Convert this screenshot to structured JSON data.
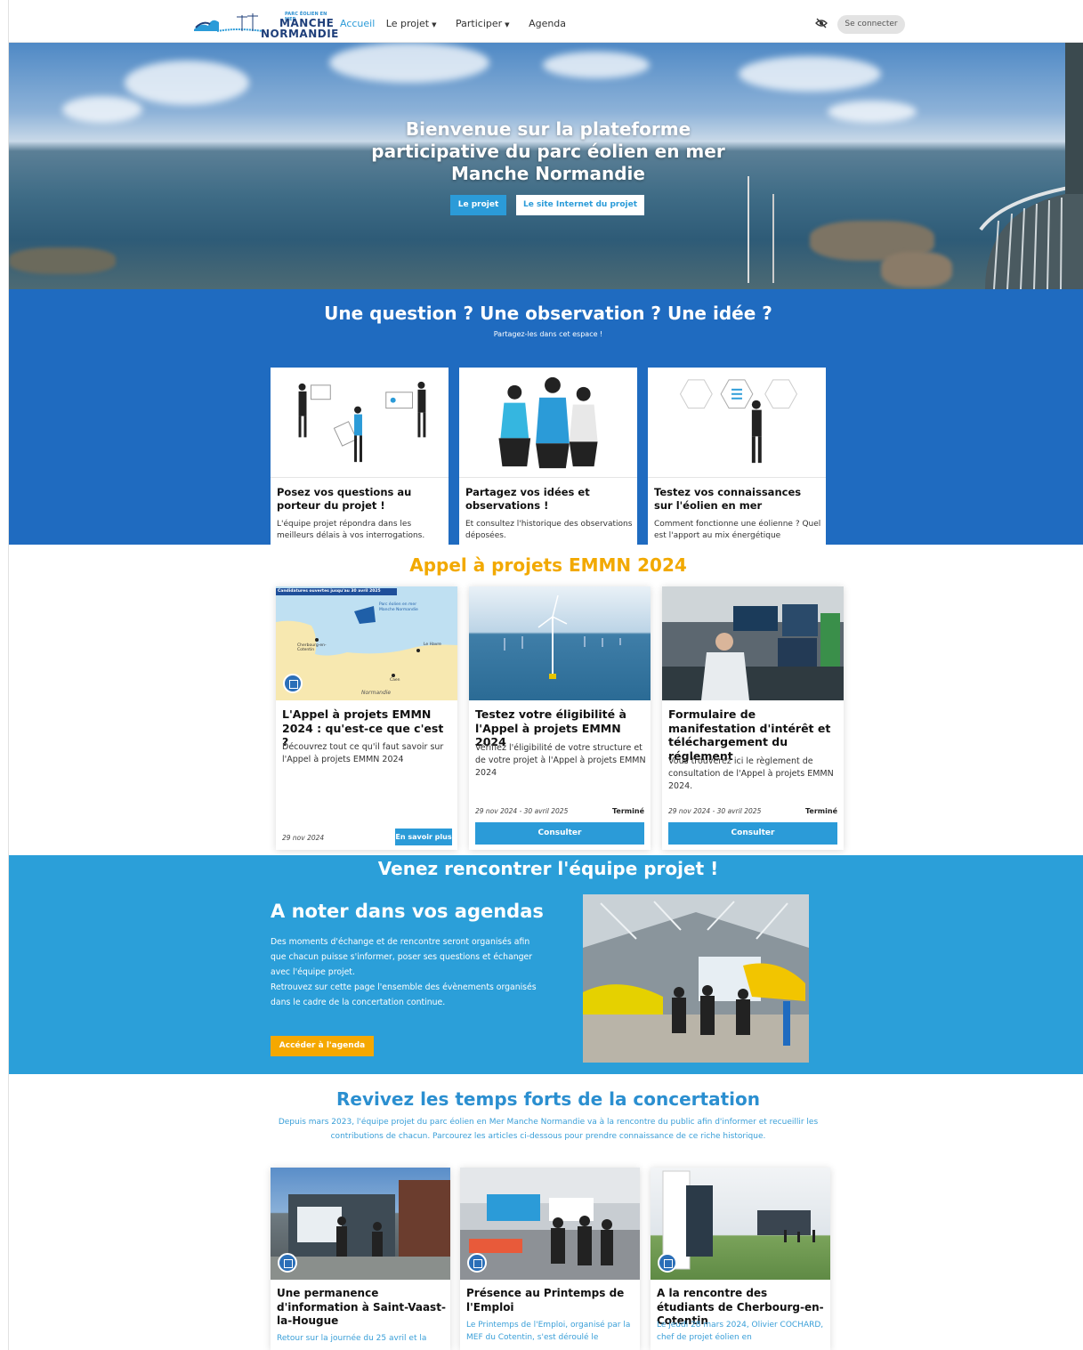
{
  "nav": {
    "logo_small": "PARC ÉOLIEN EN MER",
    "logo_line1": "MANCHE",
    "logo_line2": "NORMANDIE",
    "links": [
      "Accueil",
      "Le projet",
      "Participer",
      "Agenda"
    ],
    "login_label": "Se connecter",
    "accent": "#2b9bd8"
  },
  "hero": {
    "title": "Bienvenue sur la plateforme participative du parc éolien en mer Manche Normandie",
    "btn_project": "Le projet",
    "btn_site": "Le site Internet du projet"
  },
  "question_section": {
    "title": "Une question ? Une observation ? Une idée ?",
    "subtitle": "Partagez-les dans cet espace !",
    "background": "#1f6bc0",
    "cards": [
      {
        "title": "Posez vos questions au porteur du projet !",
        "text": "L'équipe projet répondra dans les meilleurs délais à vos interrogations."
      },
      {
        "title": "Partagez vos idées et observations !",
        "text": "Et consultez l'historique des observations déposées."
      },
      {
        "title": "Testez vos connaissances sur l'éolien en mer",
        "text": "Comment fonctionne une éolienne ? Quel est l'apport au mix énergétique"
      }
    ]
  },
  "appel_section": {
    "title": "Appel à projets EMMN 2024",
    "accent": "#f2a900",
    "cards": [
      {
        "title": "L'Appel à projets EMMN 2024 : qu'est-ce que c'est ?",
        "text": "Découvrez tout ce qu'il faut savoir sur l'Appel à projets EMMN 2024",
        "date": "29 nov 2024",
        "button": "En savoir plus",
        "map_banner": "Candidatures ouvertes jusqu'au 30 avril 2025",
        "map_label_park": "Parc éolien en mer Manche Normandie",
        "map_label_cherbourg": "Cherbourg-en-Cotentin",
        "map_label_havre": "Le Havre",
        "map_label_caen": "Caen",
        "map_label_region": "Normandie"
      },
      {
        "title": "Testez votre éligibilité à l'Appel à projets EMMN 2024",
        "text": "Vérifiez l'éligibilité de votre structure et de votre projet à l'Appel à projets EMMN 2024",
        "date": "29 nov 2024 - 30 avril 2025",
        "status": "Terminé",
        "button": "Consulter"
      },
      {
        "title": "Formulaire de manifestation d'intérêt et téléchargement du réglement",
        "text": "Vous trouverez ici le règlement de consultation de l'Appel à projets EMMN 2024.",
        "date": "29 nov 2024 - 30 avril 2025",
        "status": "Terminé",
        "button": "Consulter"
      }
    ]
  },
  "venez_section": {
    "title": "Venez rencontrer l'équipe projet !",
    "heading": "A noter dans vos agendas",
    "paragraph1": "Des moments d'échange et de rencontre seront organisés afin que chacun puisse s'informer, poser ses questions et échanger avec l'équipe projet.",
    "paragraph2": "Retrouvez sur cette page l'ensemble des évènements organisés dans le cadre de la concertation continue.",
    "button": "Accéder à l'agenda"
  },
  "revivez_section": {
    "title": "Revivez les temps forts de la concertation",
    "intro": "Depuis mars 2023, l'équipe projet du parc éolien en Mer Manche Normandie va à la rencontre du public afin d'informer et recueillir les contributions de chacun. Parcourez les articles ci-dessous pour prendre connaissance de ce riche historique.",
    "cards": [
      {
        "title": "Une permanence d'information à Saint-Vaast-la-Hougue",
        "text": "Retour sur la journée du 25 avril et la"
      },
      {
        "title": "Présence au Printemps de l'Emploi",
        "text": "Le Printemps de l'Emploi, organisé par la MEF du Cotentin, s'est déroulé le"
      },
      {
        "title": "A la rencontre des étudiants de Cherbourg-en-Cotentin",
        "text": "Le jeudi 28 mars 2024, Olivier COCHARD, chef de projet éolien en"
      }
    ]
  }
}
